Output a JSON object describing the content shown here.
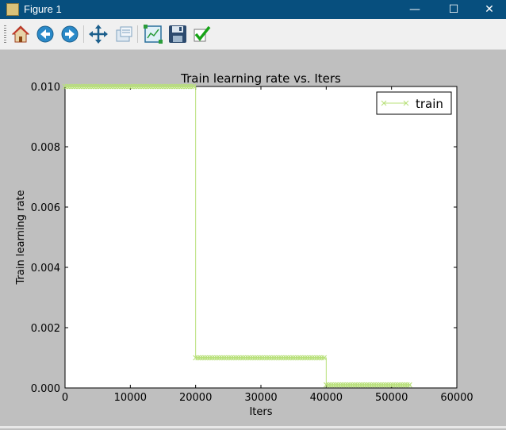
{
  "window": {
    "title": "Figure 1",
    "minimize_glyph": "—",
    "maximize_glyph": "☐",
    "close_glyph": "✕"
  },
  "toolbar": {
    "buttons": [
      {
        "name": "home-icon"
      },
      {
        "name": "back-icon"
      },
      {
        "name": "forward-icon"
      },
      {
        "name": "pan-icon"
      },
      {
        "name": "zoom-icon"
      },
      {
        "name": "subplots-icon"
      },
      {
        "name": "save-icon"
      },
      {
        "name": "check-icon"
      }
    ]
  },
  "colors": {
    "line": "#b8e07a",
    "axes_bg": "#ffffff",
    "figure_bg": "#bfbfbf",
    "titlebar": "#074f7e"
  },
  "chart_data": {
    "type": "line",
    "title": "Train learning rate  vs. Iters",
    "xlabel": "Iters",
    "ylabel": "Train learning rate",
    "xlim": [
      0,
      60000
    ],
    "ylim": [
      0,
      0.01
    ],
    "xticks": [
      "0",
      "10000",
      "20000",
      "30000",
      "40000",
      "50000",
      "60000"
    ],
    "yticks": [
      "0.000",
      "0.002",
      "0.004",
      "0.006",
      "0.008",
      "0.010"
    ],
    "legend_position": "top-right",
    "series": [
      {
        "name": "train",
        "marker": "x",
        "segments": [
          {
            "x_start": 0,
            "x_end": 20000,
            "y": 0.01
          },
          {
            "x_start": 20000,
            "x_end": 40000,
            "y": 0.001
          },
          {
            "x_start": 40000,
            "x_end": 53000,
            "y": 0.0001
          }
        ]
      }
    ],
    "grid": false
  }
}
